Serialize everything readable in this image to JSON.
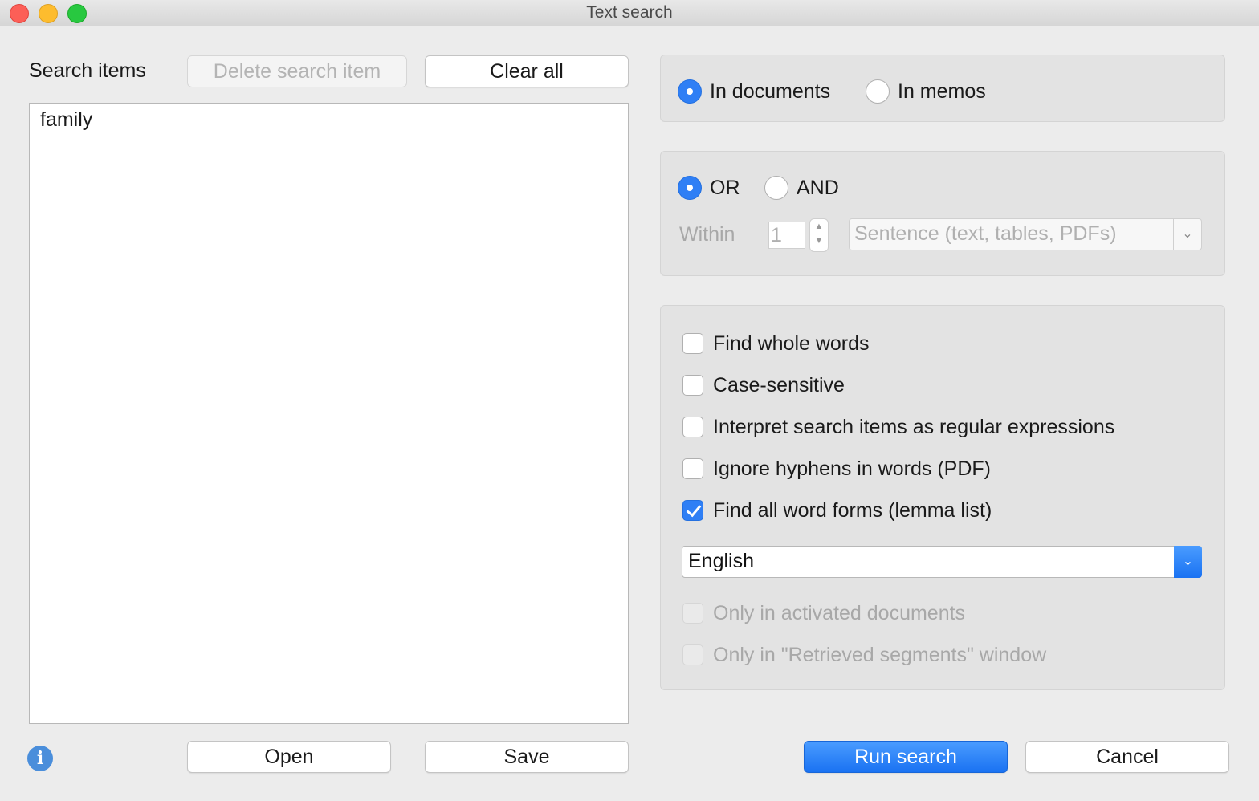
{
  "window": {
    "title": "Text search"
  },
  "left": {
    "label": "Search items",
    "delete_button": "Delete search item",
    "clear_button": "Clear all",
    "items": [
      "family"
    ],
    "open_button": "Open",
    "save_button": "Save"
  },
  "scope": {
    "in_documents": "In documents",
    "in_memos": "In memos",
    "selected": "In documents"
  },
  "logic": {
    "or_label": "OR",
    "and_label": "AND",
    "selected": "OR",
    "within_label": "Within",
    "within_value": "1",
    "unit_value": "Sentence (text, tables, PDFs)"
  },
  "options": {
    "whole_words": {
      "label": "Find whole words",
      "checked": false
    },
    "case_sensitive": {
      "label": "Case-sensitive",
      "checked": false
    },
    "regex": {
      "label": "Interpret search items as regular expressions",
      "checked": false
    },
    "ignore_hyphens": {
      "label": "Ignore hyphens in words (PDF)",
      "checked": false
    },
    "word_forms": {
      "label": "Find all word forms (lemma list)",
      "checked": true
    },
    "language": "English",
    "only_activated": {
      "label": "Only in activated documents",
      "checked": false,
      "enabled": false
    },
    "only_retrieved": {
      "label": "Only in \"Retrieved segments\" window",
      "checked": false,
      "enabled": false
    }
  },
  "actions": {
    "run_button": "Run search",
    "cancel_button": "Cancel"
  },
  "icons": {
    "info": "info-icon",
    "chevron": "chevron-down-icon",
    "stepper": "stepper-arrows-icon"
  },
  "colors": {
    "accent": "#2f7ff5",
    "window_bg": "#ececec"
  }
}
